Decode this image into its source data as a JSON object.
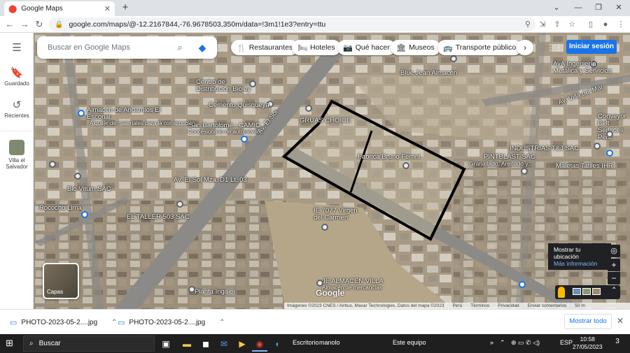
{
  "browser": {
    "tab_title": "Google Maps",
    "tab_close": "✕",
    "new_tab": "+",
    "url": "google.com/maps/@-12.2167844,-76.9678503,350m/data=!3m1!1e3?entry=ttu",
    "window_controls": [
      "⌄",
      "—",
      "❐",
      "✕"
    ]
  },
  "rail": {
    "menu_icon": "hamburger-icon",
    "items": [
      {
        "label": "Guardado",
        "icon": "bookmark-icon"
      },
      {
        "label": "Recientes",
        "icon": "history-icon"
      },
      {
        "label": "Villa el Salvador",
        "icon": "place-thumbnail"
      }
    ]
  },
  "search": {
    "placeholder": "Buscar en Google Maps"
  },
  "chips": [
    {
      "label": "Restaurantes",
      "icon": "restaurant-icon"
    },
    {
      "label": "Hoteles",
      "icon": "hotel-icon"
    },
    {
      "label": "Qué hacer",
      "icon": "camera-icon"
    },
    {
      "label": "Museos",
      "icon": "museum-icon"
    },
    {
      "label": "Transporte público",
      "icon": "transit-icon"
    }
  ],
  "header": {
    "signin_label": "Iniciar sesión"
  },
  "map": {
    "labels": [
      "AyA Ingeniería Metálica y Servicios",
      "Blue Jean Almacén",
      "Centro de Distribución Bioley",
      "Cemento Quisqueya",
      "Almacén de Andamios El Escorial",
      "Alquiler de materiales para la construcción",
      "San Bartolomé - CAMIC",
      "Concesionario de automóviles",
      "GRUAS CHOICE",
      "Fabrica Bruno Ferrini",
      "PINTBLAST SAC",
      "Granallado, Arenado y...",
      "INDUSTRIAS T&J SAC",
      "Maletas Tatiles IHR",
      "Conveyor Belt Services Peru",
      "Av. El Sol",
      "Av. El Sol Mza. D1 Lt. 03",
      "Bio Vitum SAC",
      "Rococho Lima",
      "EL TALLER 503 SAC",
      "Av. Villa del Mar",
      "IE 7077 Virgen del Carmen",
      "Planta Ingalei",
      "JE ALMACEN VILLA",
      "Almacén de mercancías"
    ],
    "layers_label": "Capas",
    "location_tip": {
      "line1": "Mostrar tu ubicación",
      "line2": "Más información"
    },
    "zoom_in": "+",
    "zoom_out": "−",
    "attribution": "Imágenes ©2023 CNES / Airbus, Maxar Technologies, Datos del mapa ©2023",
    "attrib_links": [
      "Perú",
      "Términos",
      "Privacidad",
      "Enviar comentarios"
    ],
    "scale": "50 m",
    "google_logo": "Google"
  },
  "downloads": {
    "items": [
      "PHOTO-2023-05-2....jpg",
      "PHOTO-2023-05-2....jpg"
    ],
    "show_all": "Mostrar todo",
    "close": "✕"
  },
  "taskbar": {
    "search_placeholder": "Buscar",
    "desktop_label": "Escritorio",
    "user_label": "manolo",
    "this_pc_label": "Este equipo",
    "lang": "ESP",
    "time": "10:58",
    "date": "27/05/2023",
    "notif_count": "3"
  },
  "colors": {
    "accent": "#1a73e8",
    "parcel_outline": "#000000",
    "map_base": "#b8a890"
  }
}
